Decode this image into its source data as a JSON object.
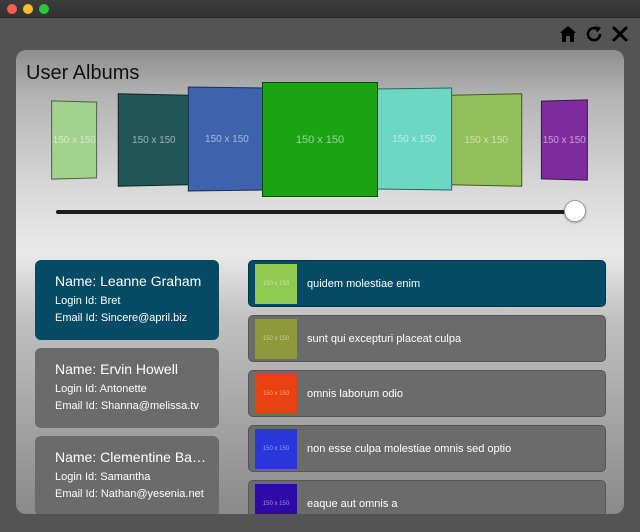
{
  "window": {
    "buttons": [
      "close",
      "minimize",
      "maximize"
    ]
  },
  "toolbar": {
    "icons": [
      "home-icon",
      "refresh-icon",
      "close-icon"
    ]
  },
  "page": {
    "title": "User Albums"
  },
  "coverflow": {
    "items": [
      {
        "label": "150 x 150",
        "color": "#a3d18e"
      },
      {
        "label": "150 x 150",
        "color": "#215558"
      },
      {
        "label": "150 x 150",
        "color": "#3d63ad"
      },
      {
        "label": "150 x 150",
        "color": "#1aa313"
      },
      {
        "label": "150 x 150",
        "color": "#6dd7c6"
      },
      {
        "label": "150 x 150",
        "color": "#92c05a"
      },
      {
        "label": "150 x 150",
        "color": "#7e2c9d"
      }
    ],
    "slider_value_fraction": 1.0
  },
  "users": [
    {
      "name": "Name: Leanne Graham",
      "login": "Login Id: Bret",
      "email": "Email Id: Sincere@april.biz",
      "active": true
    },
    {
      "name": "Name: Ervin Howell",
      "login": "Login Id: Antonette",
      "email": "Email Id: Shanna@melissa.tv",
      "active": false
    },
    {
      "name": "Name: Clementine Bauch",
      "login": "Login Id: Samantha",
      "email": "Email Id: Nathan@yesenia.net",
      "active": false
    }
  ],
  "albums": [
    {
      "title": "quidem molestiae enim",
      "thumb_label": "150 x 150",
      "thumb_color": "#92c952",
      "active": true
    },
    {
      "title": "sunt qui excepturi placeat culpa",
      "thumb_label": "150 x 150",
      "thumb_color": "#8e9a3a",
      "active": false
    },
    {
      "title": "omnis laborum odio",
      "thumb_label": "150 x 150",
      "thumb_color": "#e9410f",
      "active": false
    },
    {
      "title": "non esse culpa molestiae omnis sed optio",
      "thumb_label": "150 x 150",
      "thumb_color": "#2a35dc",
      "active": false
    },
    {
      "title": "eaque aut omnis a",
      "thumb_label": "150 x 150",
      "thumb_color": "#2e0aa8",
      "active": false
    }
  ],
  "colors": {
    "accent": "#064b66",
    "card": "#6b6b6b"
  }
}
